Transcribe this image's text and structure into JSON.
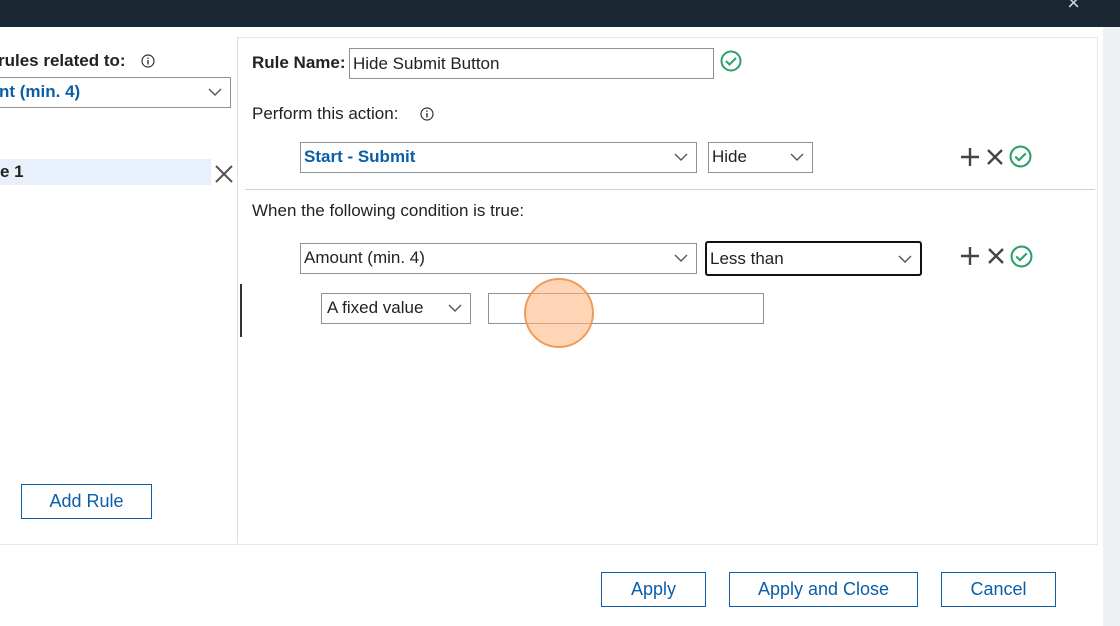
{
  "window": {
    "close_label": "×"
  },
  "left": {
    "related_label": "rules related to:",
    "field_value": "nt (min. 4)",
    "rule_item": "e 1",
    "add_rule_button": "Add Rule"
  },
  "rule": {
    "name_label": "Rule Name:",
    "name_value": "Hide Submit Button",
    "action_label": "Perform this action:",
    "action_target": "Start - Submit",
    "action_type": "Hide",
    "condition_label": "When the following condition is true:",
    "condition_field": "Amount (min. 4)",
    "condition_operator": "Less than",
    "value_source": "A fixed value",
    "value_input": ""
  },
  "footer": {
    "apply": "Apply",
    "apply_close": "Apply and Close",
    "cancel": "Cancel"
  },
  "colors": {
    "accent": "#0b5ea8",
    "success": "#2e9e6a",
    "titlebar": "#1b2733"
  }
}
